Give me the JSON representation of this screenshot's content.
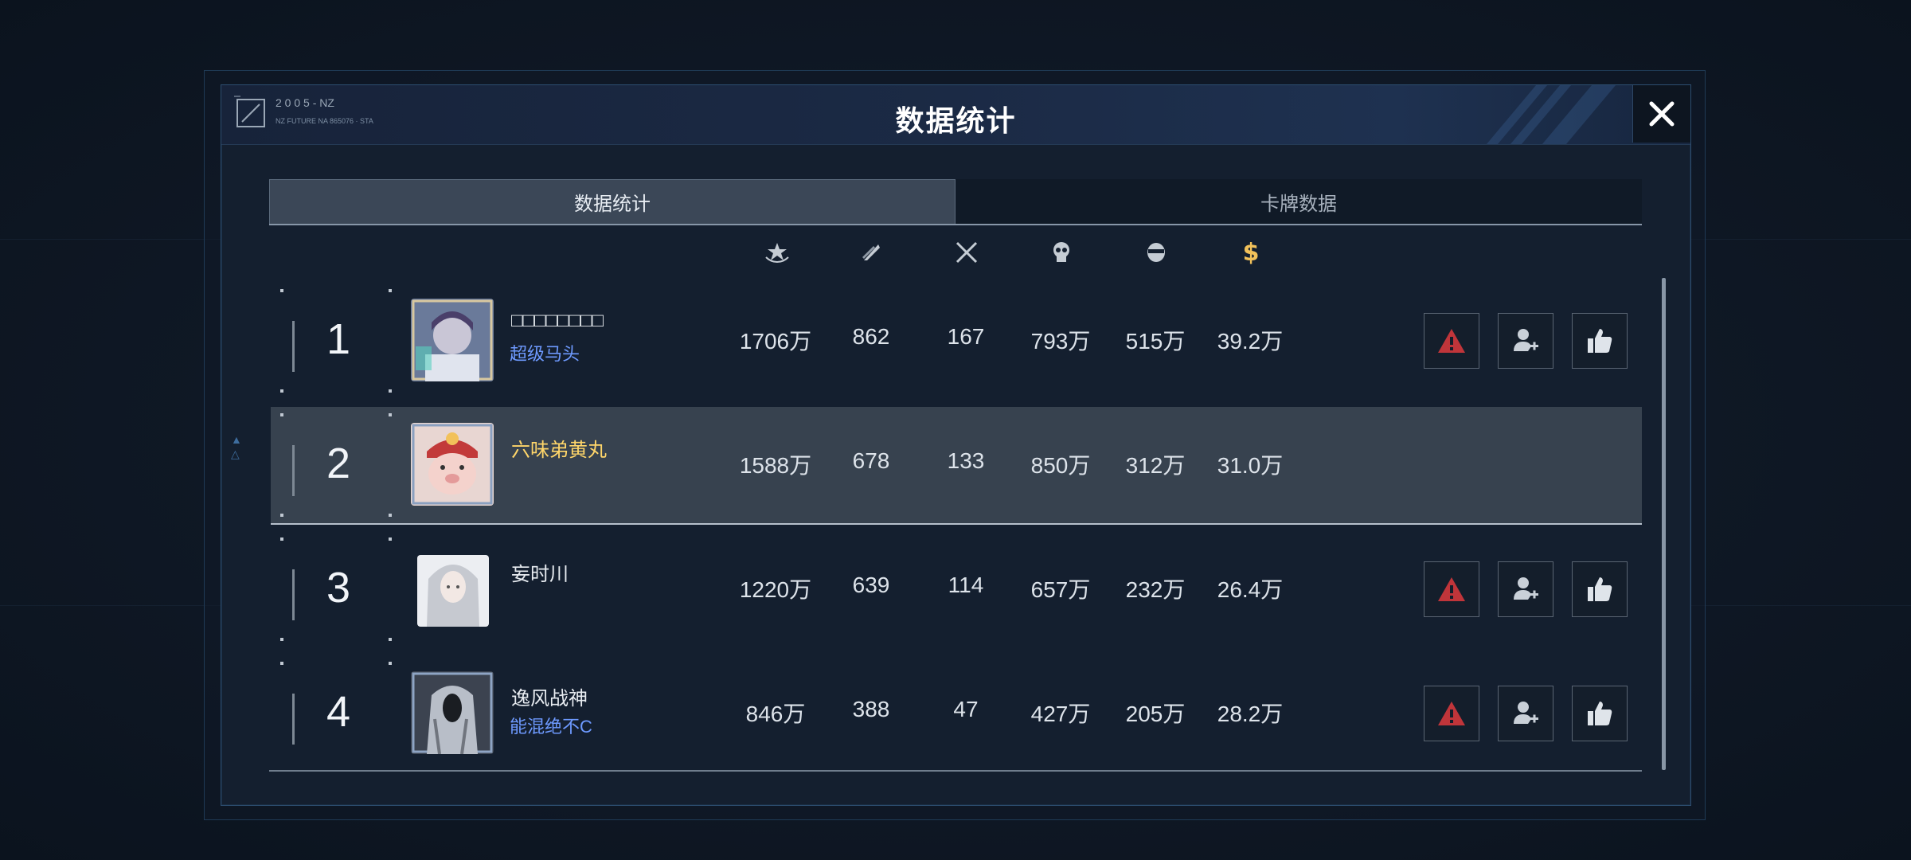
{
  "window": {
    "title": "数据统计",
    "logo_text_line1": "2 0 0 5 - NZ",
    "logo_text_line2": "NZ FUTURE NA 865076 · STA"
  },
  "tabs": [
    {
      "label": "数据统计",
      "active": true
    },
    {
      "label": "卡牌数据",
      "active": false
    }
  ],
  "columns": [
    {
      "icon": "star-wings-icon"
    },
    {
      "icon": "feathers-icon"
    },
    {
      "icon": "crossed-swords-icon"
    },
    {
      "icon": "skull-icon"
    },
    {
      "icon": "masked-head-icon"
    },
    {
      "icon": "dollar-icon",
      "color": "#f2c15a"
    }
  ],
  "players": [
    {
      "rank": "1",
      "name": "□□□□□□□□",
      "title": "超级马头",
      "stats": [
        "1706万",
        "862",
        "167",
        "793万",
        "515万",
        "39.2万"
      ],
      "highlight": false,
      "actions": true,
      "avatar": "anime-purple-hair"
    },
    {
      "rank": "2",
      "name": "六味弟黄丸",
      "title": "",
      "stats": [
        "1588万",
        "678",
        "133",
        "850万",
        "312万",
        "31.0万"
      ],
      "highlight": true,
      "actions": false,
      "avatar": "cartoon-pig"
    },
    {
      "rank": "3",
      "name": "妄时川",
      "title": "",
      "stats": [
        "1220万",
        "639",
        "114",
        "657万",
        "232万",
        "26.4万"
      ],
      "highlight": false,
      "actions": true,
      "avatar": "white-hair-girl"
    },
    {
      "rank": "4",
      "name": "逸风战神",
      "title": "能混绝不C",
      "stats": [
        "846万",
        "388",
        "47",
        "427万",
        "205万",
        "28.2万"
      ],
      "highlight": false,
      "actions": true,
      "avatar": "dark-figure"
    }
  ],
  "action_buttons": [
    {
      "name": "report-button",
      "icon": "warning-icon",
      "color": "#c0353a"
    },
    {
      "name": "add-friend-button",
      "icon": "add-user-icon",
      "color": "#c9d0d8"
    },
    {
      "name": "like-button",
      "icon": "thumbs-up-icon",
      "color": "#dfe4ea"
    }
  ],
  "colors": {
    "accent_title_blue": "#6e9aff",
    "gold_name": "#ffd66a",
    "highlight_row": "#37424f",
    "window_border": "#2d4e70"
  }
}
